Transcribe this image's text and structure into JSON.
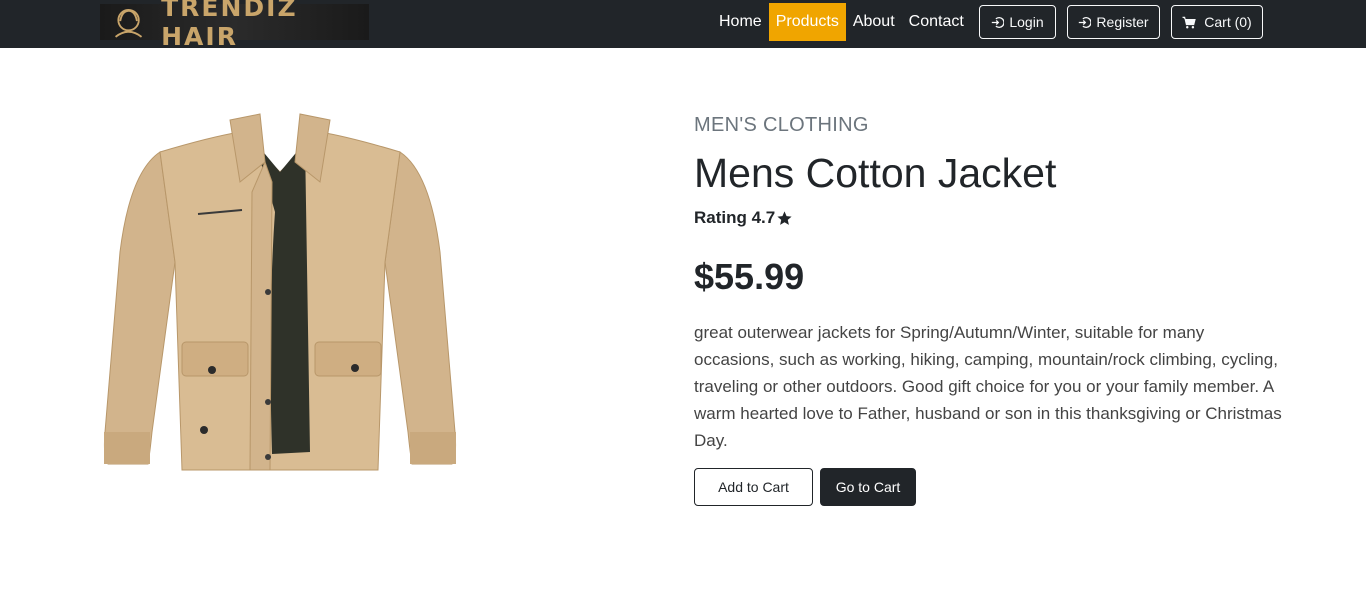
{
  "brand": {
    "name": "TRENDIZ HAIR"
  },
  "nav": {
    "links": [
      {
        "label": "Home"
      },
      {
        "label": "Products",
        "active": true
      },
      {
        "label": "About"
      },
      {
        "label": "Contact"
      }
    ],
    "login_label": "Login",
    "register_label": "Register",
    "cart_label": "Cart (0)"
  },
  "product": {
    "category": "MEN'S CLOTHING",
    "title": "Mens Cotton Jacket",
    "rating_label": "Rating 4.7",
    "price": "$55.99",
    "description": "great outerwear jackets for Spring/Autumn/Winter, suitable for many occasions, such as working, hiking, camping, mountain/rock climbing, cycling, traveling or other outdoors. Good gift choice for you or your family member. A warm hearted love to Father, husband or son in this thanksgiving or Christmas Day.",
    "add_to_cart_label": "Add to Cart",
    "go_to_cart_label": "Go to Cart"
  },
  "colors": {
    "navbar_bg": "#212529",
    "active_accent": "#f0a500",
    "jacket_color": "#d2b48c"
  },
  "icons": {
    "login": "login-icon",
    "register": "register-icon",
    "cart": "cart-icon",
    "rating": "star-icon"
  }
}
